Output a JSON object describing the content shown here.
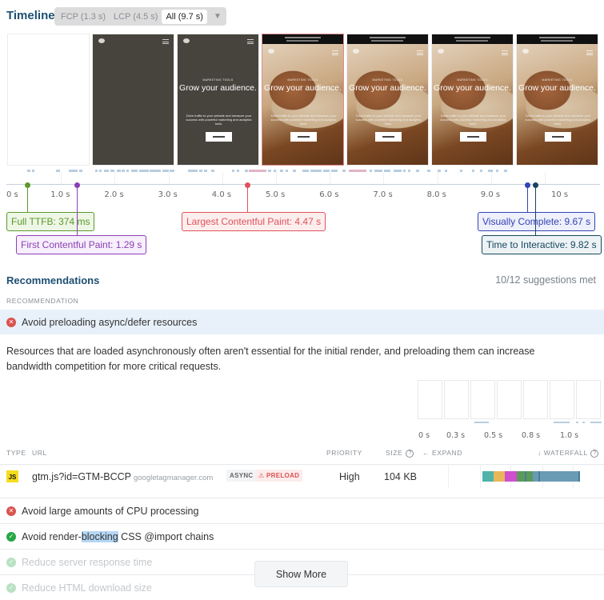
{
  "timeline": {
    "title": "Timeline",
    "filters": [
      {
        "label": "FCP (1.3 s)",
        "active": false
      },
      {
        "label": "LCP (4.5 s)",
        "active": false
      },
      {
        "label": "All (9.7 s)",
        "active": true
      }
    ],
    "dropdown_icon": "caret-down-icon",
    "frames": [
      {
        "type": "blank"
      },
      {
        "type": "dark"
      },
      {
        "type": "dark-text",
        "eyebrow": "MARKETING TOOLS",
        "hero": "Grow your audience.",
        "body": "Drive traffic to your website and measure your success with powerful marketing and analytics tools.",
        "cta": "GET STARTED"
      },
      {
        "type": "photo",
        "lcp": true,
        "eyebrow": "MARKETING TOOLS",
        "hero": "Grow your audience.",
        "body": "Drive traffic to your website and measure your success with powerful marketing and analytics tools.",
        "cta": "GET STARTED"
      },
      {
        "type": "photo",
        "eyebrow": "MARKETING TOOLS",
        "hero": "Grow your audience.",
        "body": "Drive traffic to your website and measure your success with powerful marketing and analytics tools.",
        "cta": "GET STARTED"
      },
      {
        "type": "photo",
        "eyebrow": "MARKETING TOOLS",
        "hero": "Grow your audience.",
        "body": "Drive traffic to your website and measure your success with powerful marketing and analytics tools.",
        "cta": "GET STARTED"
      },
      {
        "type": "photo",
        "eyebrow": "MARKETING TOOLS",
        "hero": "Grow your audience.",
        "body": "Drive traffic to your website and measure your success with powerful marketing and analytics tools.",
        "cta": "GET STARTED"
      }
    ],
    "axis_ticks": [
      "0 s",
      "1.0 s",
      "2.0 s",
      "3.0 s",
      "4.0 s",
      "5.0 s",
      "6.0 s",
      "7.0 s",
      "8.0 s",
      "9.0 s",
      "10 s"
    ],
    "axis_max_seconds": 10.5,
    "milestones": [
      {
        "id": "ttfb",
        "label": "Full TTFB: 374 ms",
        "time_s": 0.374,
        "color": "#5a9a2a",
        "bg": "#eef6e6"
      },
      {
        "id": "fcp",
        "label": "First Contentful Paint: 1.29 s",
        "time_s": 1.29,
        "color": "#8a3fb5",
        "bg": "#f7effb"
      },
      {
        "id": "lcp",
        "label": "Largest Contentful Paint: 4.47 s",
        "time_s": 4.47,
        "color": "#e0525a",
        "bg": "#fdeeee"
      },
      {
        "id": "vc",
        "label": "Visually Complete: 9.67 s",
        "time_s": 9.67,
        "color": "#3343b5",
        "bg": "#eef0fb"
      },
      {
        "id": "tti",
        "label": "Time to Interactive: 9.82 s",
        "time_s": 9.82,
        "color": "#16455e",
        "bg": "#edf3f5"
      }
    ]
  },
  "recommendations": {
    "title": "Recommendations",
    "met_summary": "10/12 suggestions met",
    "column_header": "RECOMMENDATION",
    "items": [
      {
        "label": "Avoid preloading async/defer resources",
        "status": "fail",
        "expanded": true
      },
      {
        "label": "Avoid large amounts of CPU processing",
        "status": "fail"
      },
      {
        "label_pre": "Avoid render-",
        "label_hl": "blocking",
        "label_post": " CSS @import chains",
        "status": "pass"
      },
      {
        "label": "Reduce server response time",
        "status": "pass",
        "faded": true
      },
      {
        "label": "Reduce HTML download size",
        "status": "pass",
        "faded": true
      }
    ],
    "detail": {
      "description": "Resources that are loaded asynchronously often aren't essential for the initial render, and preloading them can increase bandwidth competition for more critical requests.",
      "mini_filmstrip_ticks": [
        "0 s",
        "0.3 s",
        "0.5 s",
        "0.8 s",
        "1.0 s"
      ],
      "table_headers": {
        "type": "TYPE",
        "url": "URL",
        "priority": "PRIORITY",
        "size": "SIZE",
        "expand": "← EXPAND",
        "waterfall": "↓ WATERFALL",
        "help_glyph": "?"
      },
      "resources": [
        {
          "type_badge": "JS",
          "file": "gtm.js?id=GTM-BCCP",
          "host": "googletagmanager.com",
          "tags": [
            "ASYNC",
            "PRELOAD"
          ],
          "preload_warning_icon": "⚠",
          "priority": "High",
          "size": "104 KB",
          "waterfall_segments": [
            {
              "phase": "dns",
              "color": "#4fb3a9"
            },
            {
              "phase": "connect",
              "color": "#e8b75a"
            },
            {
              "phase": "ssl",
              "color": "#cf4fcf"
            },
            {
              "phase": "wait",
              "color": "#5a9a5a"
            },
            {
              "phase": "download",
              "color": "#6a9bb5"
            }
          ]
        }
      ]
    },
    "show_more_label": "Show More",
    "fail_glyph": "✕",
    "pass_glyph": "✓"
  }
}
